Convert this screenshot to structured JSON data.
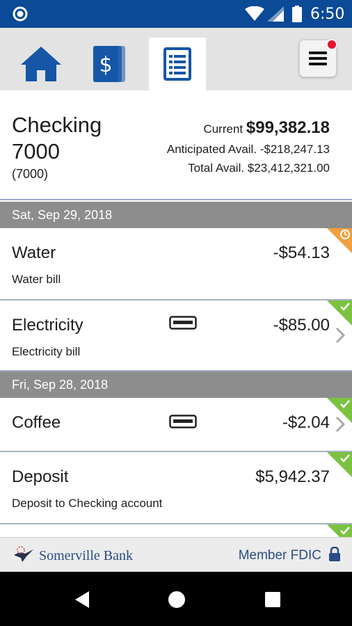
{
  "status_bar": {
    "time": "6:50"
  },
  "nav": {
    "tabs": [
      {
        "name": "home",
        "icon": "home-icon"
      },
      {
        "name": "accounts",
        "icon": "dollar-cards-icon"
      },
      {
        "name": "activity",
        "icon": "document-list-icon",
        "selected": true
      }
    ],
    "menu_icon": "hamburger-menu-icon",
    "has_notification": true
  },
  "account": {
    "name": "Checking 7000",
    "number": "(7000)",
    "current_label": "Current",
    "current_amount": "$99,382.18",
    "anticipated_label": "Anticipated Avail.",
    "anticipated_amount": "-$218,247.13",
    "total_label": "Total Avail.",
    "total_amount": "$23,412,321.00"
  },
  "groups": [
    {
      "date": "Sat, Sep 29, 2018",
      "transactions": [
        {
          "title": "Water",
          "description": "Water bill",
          "amount": "-$54.13",
          "status": "pending",
          "card": false,
          "chevron": false
        },
        {
          "title": "Electricity",
          "description": "Electricity bill",
          "amount": "-$85.00",
          "status": "cleared",
          "card": true,
          "chevron": true
        }
      ]
    },
    {
      "date": "Fri, Sep 28, 2018",
      "transactions": [
        {
          "title": "Coffee",
          "description": "",
          "amount": "-$2.04",
          "status": "cleared",
          "card": true,
          "chevron": true
        },
        {
          "title": "Deposit",
          "description": "Deposit to Checking account",
          "amount": "$5,942.37",
          "status": "cleared",
          "card": false,
          "chevron": false
        }
      ]
    }
  ],
  "footer": {
    "bank_name": "Somerville Bank",
    "fdic_label": "Member FDIC"
  },
  "colors": {
    "status_bar": "#0a4a96",
    "brand_blue": "#1656a6",
    "pending": "#f0a040",
    "cleared": "#7cc241",
    "date_header": "#8d8d8d"
  }
}
